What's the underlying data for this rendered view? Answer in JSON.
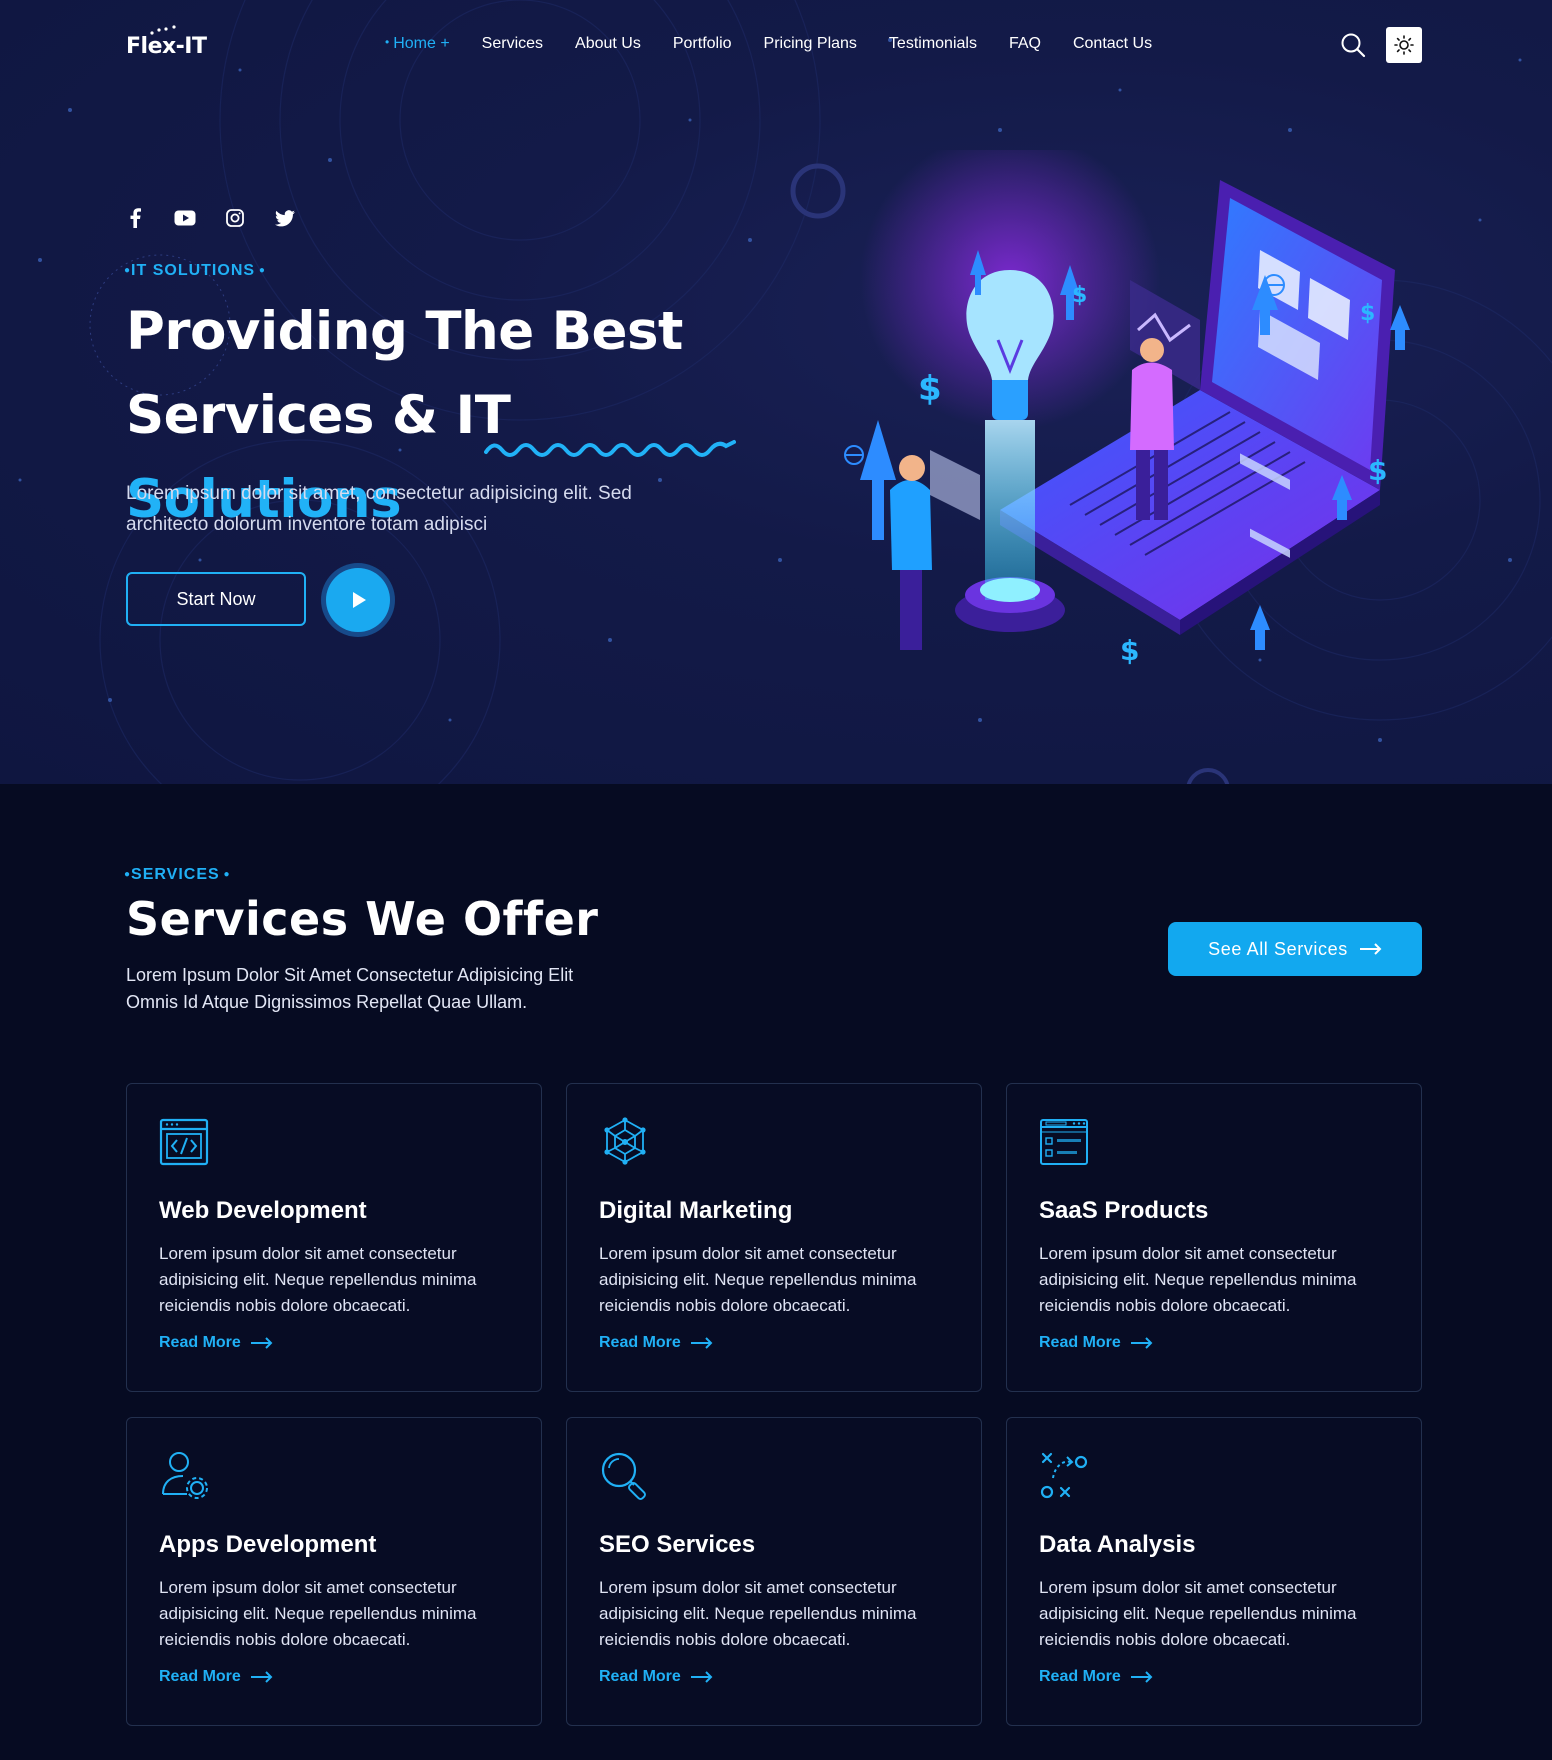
{
  "brand": {
    "logo_text": "Flex-IT"
  },
  "nav": {
    "items": [
      "Home +",
      "Services",
      "About Us",
      "Portfolio",
      "Pricing Plans",
      "Testimonials",
      "FAQ",
      "Contact Us"
    ],
    "active_index": 0
  },
  "hero": {
    "eyebrow": "IT SOLUTIONS",
    "title_line1": "Providing The Best",
    "title_line2_prefix": "Services & IT",
    "title_line2_accent": "Solutions",
    "description": "Lorem ipsum dolor sit amet, consectetur adipisicing elit. Sed architecto dolorum inventore totam adipisci",
    "cta_label": "Start Now",
    "socials": [
      "facebook-icon",
      "youtube-icon",
      "instagram-icon",
      "twitter-icon"
    ]
  },
  "services": {
    "eyebrow": "SERVICES",
    "title": "Services We Offer",
    "description": "Lorem Ipsum Dolor Sit Amet Consectetur Adipisicing Elit Omnis Id Atque Dignissimos Repellat Quae Ullam.",
    "see_all_label": "See All Services",
    "cards": [
      {
        "title": "Web Development",
        "icon": "code-window-icon",
        "text": "Lorem ipsum dolor sit amet consectetur adipisicing elit. Neque repellendus minima reiciendis nobis dolore obcaecati.",
        "link": "Read More"
      },
      {
        "title": "Digital Marketing",
        "icon": "network-globe-icon",
        "text": "Lorem ipsum dolor sit amet consectetur adipisicing elit. Neque repellendus minima reiciendis nobis dolore obcaecati.",
        "link": "Read More"
      },
      {
        "title": "SaaS Products",
        "icon": "domain-window-icon",
        "text": "Lorem ipsum dolor sit amet consectetur adipisicing elit. Neque repellendus minima reiciendis nobis dolore obcaecati.",
        "link": "Read More"
      },
      {
        "title": "Apps Development",
        "icon": "user-gear-icon",
        "text": "Lorem ipsum dolor sit amet consectetur adipisicing elit. Neque repellendus minima reiciendis nobis dolore obcaecati.",
        "link": "Read More"
      },
      {
        "title": "SEO Services",
        "icon": "magnifier-icon",
        "text": "Lorem ipsum dolor sit amet consectetur adipisicing elit. Neque repellendus minima reiciendis nobis dolore obcaecati.",
        "link": "Read More"
      },
      {
        "title": "Data Analysis",
        "icon": "strategy-icon",
        "text": "Lorem ipsum dolor sit amet consectetur adipisicing elit. Neque repellendus minima reiciendis nobis dolore obcaecati.",
        "link": "Read More"
      }
    ]
  },
  "colors": {
    "accent": "#20b0f5",
    "hero_bg": "#131a48",
    "section_bg": "#060b22",
    "card_border": "#23304e"
  }
}
